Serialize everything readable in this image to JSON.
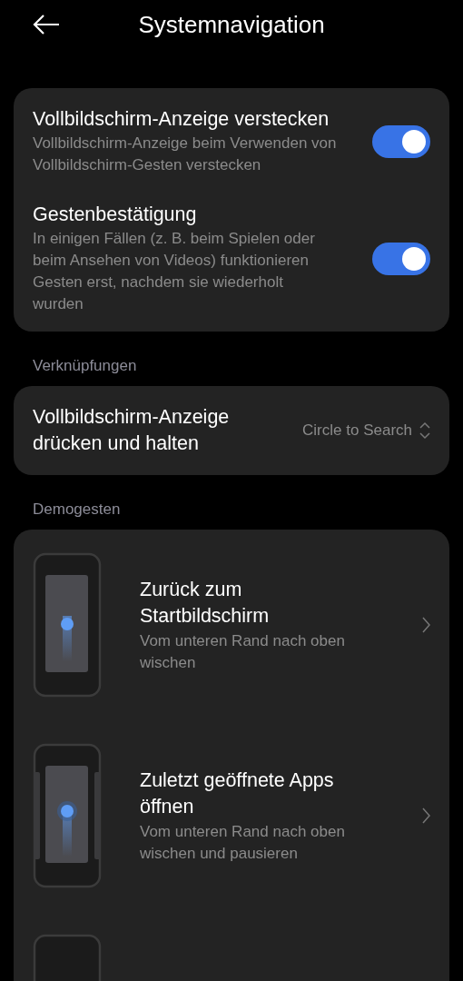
{
  "header": {
    "title": "Systemnavigation"
  },
  "settings": [
    {
      "title": "Vollbildschirm-Anzeige verstecken",
      "description": "Vollbildschirm-Anzeige beim Verwenden von Vollbildschirm-Gesten verstecken",
      "on": true
    },
    {
      "title": "Gestenbestätigung",
      "description": "In einigen Fällen (z. B. beim Spielen oder beim Ansehen von Videos) funktionieren Gesten erst, nachdem sie wiederholt wurden",
      "on": true
    }
  ],
  "shortcuts": {
    "label": "Verknüpfungen",
    "title": "Vollbildschirm-Anzeige drücken und halten",
    "value": "Circle to Search"
  },
  "demos": {
    "label": "Demogesten",
    "items": [
      {
        "kind": "home",
        "title": "Zurück zum Startbildschirm",
        "description": "Vom unteren Rand nach oben wischen"
      },
      {
        "kind": "recents",
        "title": "Zuletzt geöffnete Apps öffnen",
        "description": "Vom unteren Rand nach oben wischen und pausieren"
      },
      {
        "kind": "blank"
      }
    ]
  }
}
